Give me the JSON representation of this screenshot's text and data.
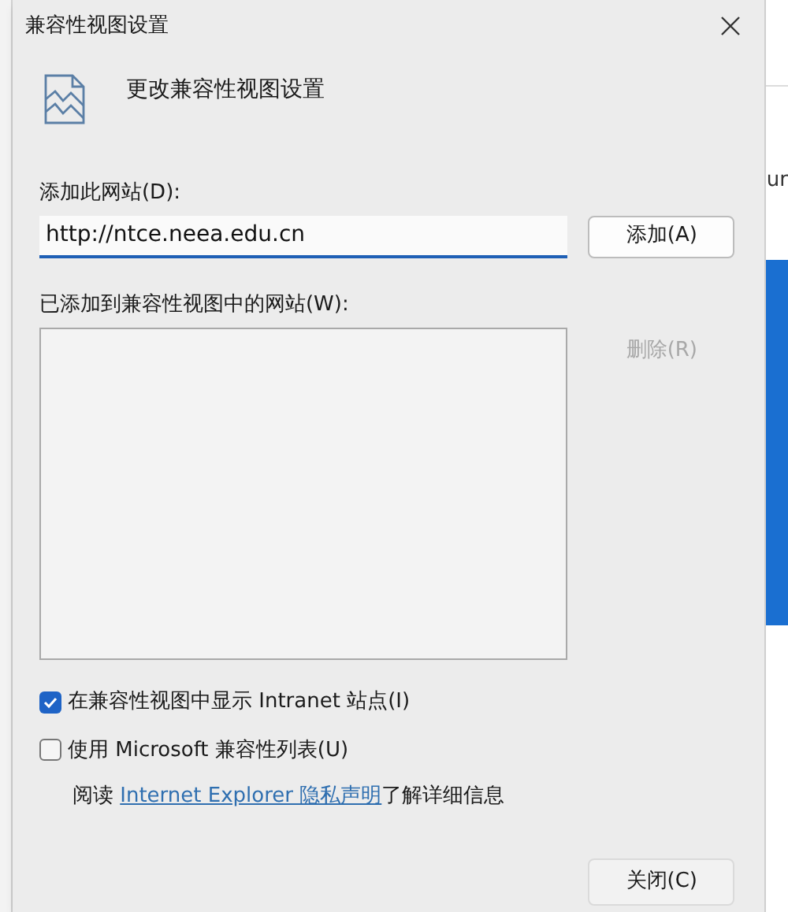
{
  "background": {
    "text": "ur"
  },
  "dialog": {
    "title": "兼容性视图设置",
    "heading": "更改兼容性视图设置",
    "add_label": "添加此网站(D):",
    "site_field": {
      "value": "http://ntce.neea.edu.cn"
    },
    "add_button": {
      "label": "添加(A)",
      "disabled": false
    },
    "list_label": "已添加到兼容性视图中的网站(W):",
    "remove_button": {
      "label": "删除(R)",
      "disabled": true
    },
    "options": [
      {
        "label": "在兼容性视图中显示 Intranet 站点(I)",
        "checked": true
      },
      {
        "label": "使用 Microsoft 兼容性列表(U)",
        "checked": false
      }
    ],
    "privacy": {
      "before": "阅读 ",
      "link": "Internet Explorer 隐私声明",
      "after": "了解详细信息"
    },
    "close_button": {
      "label": "关闭(C)"
    }
  }
}
